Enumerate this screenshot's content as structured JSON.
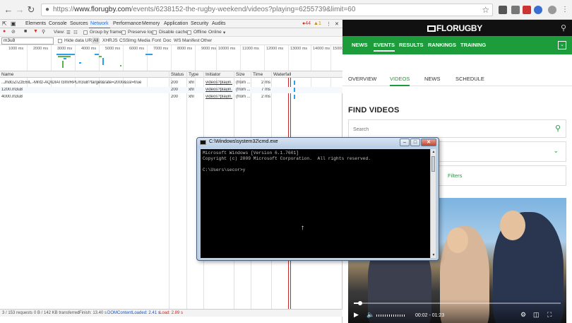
{
  "browser": {
    "url_prefix": "https://",
    "url_host": "www.florugby.com",
    "url_path": "/events/6238152-the-rugby-weekend/videos?playing=6255739&limit=60"
  },
  "devtools": {
    "tabs": [
      "Elements",
      "Console",
      "Sources",
      "Network",
      "Performance",
      "Memory",
      "Application",
      "Security",
      "Audits"
    ],
    "active_tab": "Network",
    "errors": "44",
    "warnings": "1",
    "toolbar": {
      "view_label": "View:",
      "group_by_frame": "Group by frame",
      "preserve_log": "Preserve log",
      "disable_cache": "Disable cache",
      "offline": "Offline",
      "online": "Online"
    },
    "filter_value": "m3u8",
    "hide_data_urls": "Hide data URLs",
    "type_filters": [
      "All",
      "XHR",
      "JS",
      "CSS",
      "Img",
      "Media",
      "Font",
      "Doc",
      "WS",
      "Manifest",
      "Other"
    ],
    "overview_ticks": [
      "1000 ms",
      "2000 ms",
      "3000 ms",
      "4000 ms",
      "5000 ms",
      "6000 ms",
      "7000 ms",
      "8000 ms",
      "9000 ms",
      "10000 ms",
      "11000 ms",
      "12000 ms",
      "13000 ms",
      "14000 ms",
      "15000"
    ],
    "columns": [
      "Name",
      "Status",
      "Type",
      "Initiator",
      "Size",
      "Time",
      "Waterfall"
    ],
    "rows": [
      {
        "name": "..JhdGZrZzE6IL.-Mntz-AQIDIATI3mrRPLm3u8?target&rate=2000&ssl=true",
        "status": "200",
        "type": "xhr",
        "initiator": "videos?playin...",
        "size": "(from ...",
        "time": "2 ms"
      },
      {
        "name": "1200.m3u8",
        "status": "200",
        "type": "xhr",
        "initiator": "videos?playin...",
        "size": "(from ...",
        "time": "7 ms"
      },
      {
        "name": "4000.m3u8",
        "status": "200",
        "type": "xhr",
        "initiator": "videos?playin...",
        "size": "(from ...",
        "time": "2 ms"
      }
    ],
    "status_bar": {
      "requests": "3 / 153 requests",
      "transferred": "0 B / 142 KB transferred",
      "finish": "Finish: 13.40 s",
      "dom_loaded": "DOMContentLoaded: 2.41 s",
      "load": "Load: 2.89 s"
    }
  },
  "site": {
    "logo": "FLORUGBY",
    "nav": [
      "NEWS",
      "EVENTS",
      "RESULTS",
      "RANKINGS",
      "TRAINING"
    ],
    "active_nav": "EVENTS",
    "subtabs": [
      "OVERVIEW",
      "VIDEOS",
      "NEWS",
      "SCHEDULE"
    ],
    "active_subtab": "VIDEOS",
    "find_title": "FIND VIDEOS",
    "search_placeholder": "Search",
    "filters_label": "Filters",
    "video": {
      "time": "00:02 - 01:23",
      "progress_fraction": 0.03
    },
    "colors": {
      "brand_green": "#1d9c3b",
      "header_black": "#111111"
    }
  },
  "cmd": {
    "title": "C:\\Windows\\system32\\cmd.exe",
    "lines": [
      "Microsoft Windows [Version 6.1.7601]",
      "Copyright (c) 2009 Microsoft Corporation.  All rights reserved.",
      "",
      "C:\\Users\\secor>y"
    ]
  }
}
